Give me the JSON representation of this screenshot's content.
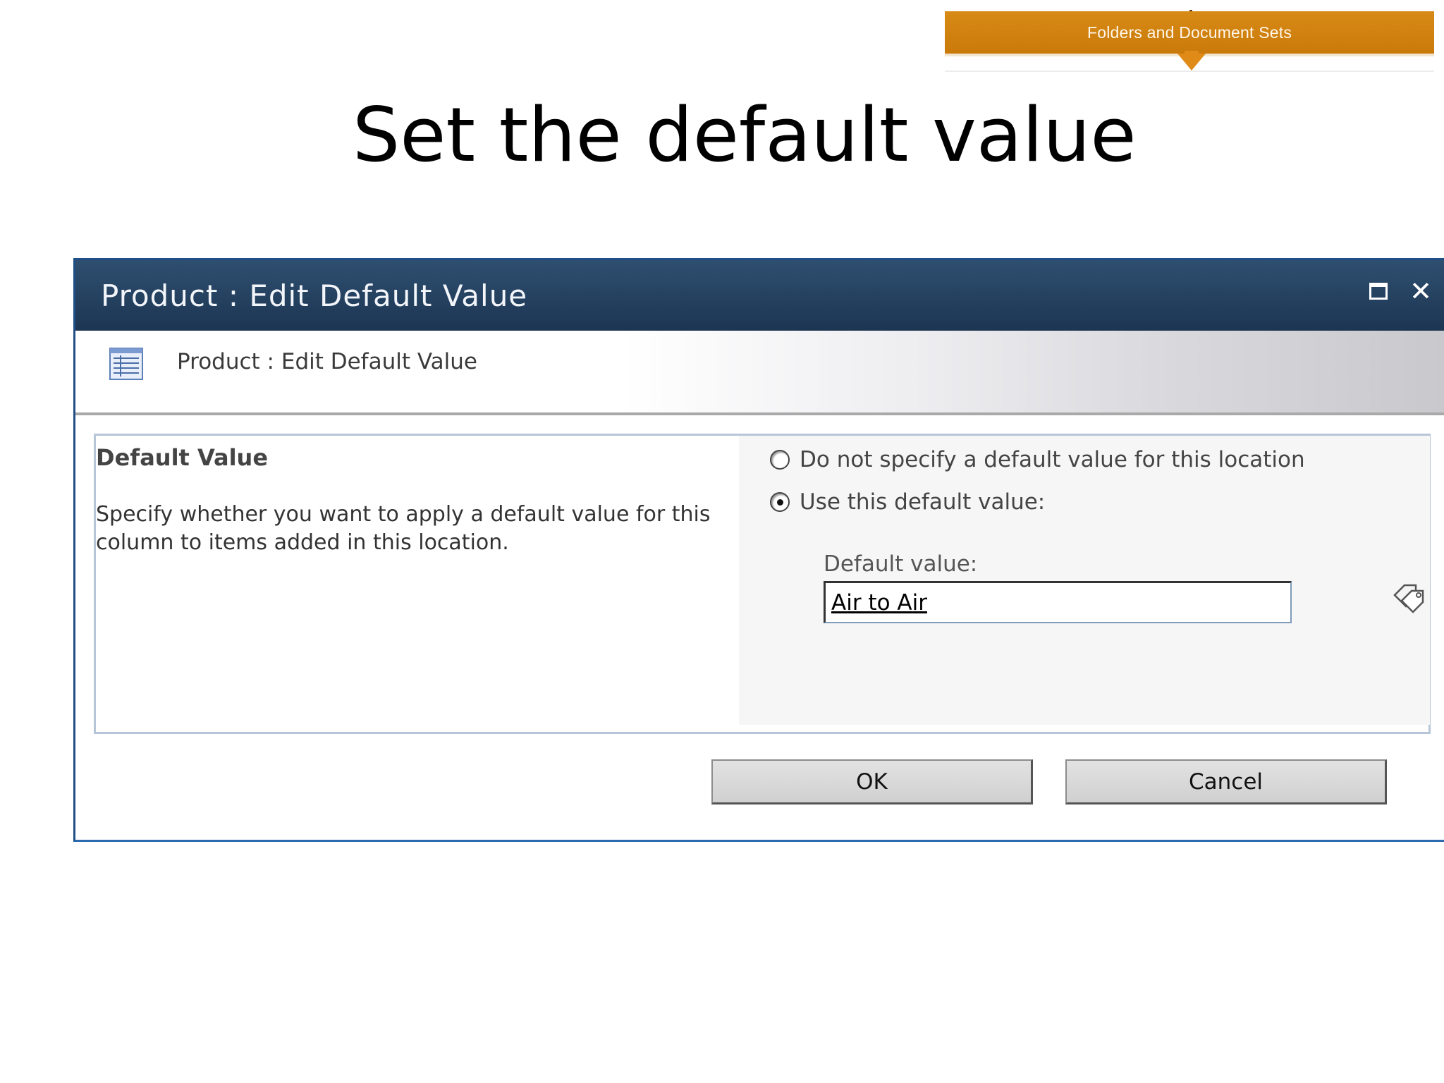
{
  "banner": {
    "label": "Folders and Document Sets",
    "color": "#d18214"
  },
  "slide": {
    "title": "Set the default value"
  },
  "dialog": {
    "title": "Product : Edit Default Value",
    "subheader": "Product : Edit Default Value",
    "icons": {
      "maximize": "maximize-icon",
      "close": "close-icon",
      "list": "list-icon",
      "tag": "tag-icon"
    },
    "section": {
      "title": "Default Value",
      "description": "Specify whether you want to apply a default value for this column to items added in this location."
    },
    "options": [
      {
        "label": "Do not specify a default value for this location",
        "checked": false
      },
      {
        "label": "Use this default value:",
        "checked": true
      }
    ],
    "field": {
      "label": "Default value:",
      "value": "Air to Air"
    },
    "buttons": {
      "ok": "OK",
      "cancel": "Cancel"
    },
    "colors": {
      "titlebar": "#243f5e",
      "border": "#1f4f86"
    }
  }
}
